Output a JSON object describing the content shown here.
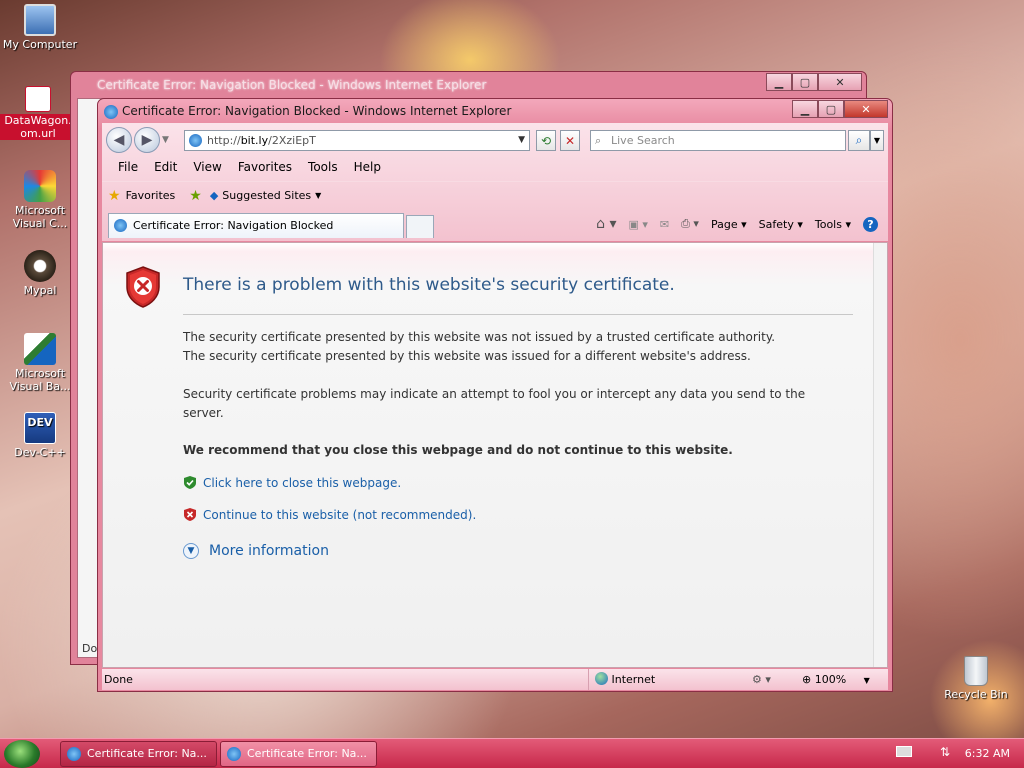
{
  "desktop": {
    "icons": [
      {
        "label": "My Computer"
      },
      {
        "label": "DataWagon.\nom.url"
      },
      {
        "label": "Microsoft\nVisual C..."
      },
      {
        "label": "Mypal"
      },
      {
        "label": "Microsoft\nVisual Ba..."
      },
      {
        "label": "Dev-C++"
      },
      {
        "label": "Recycle Bin"
      }
    ]
  },
  "back_window": {
    "title": "Certificate Error: Navigation Blocked - Windows Internet Explorer",
    "status": "Don"
  },
  "window": {
    "title": "Certificate Error: Navigation Blocked - Windows Internet Explorer",
    "address": {
      "scheme": "http://",
      "host": "bit.ly",
      "path": "/2XziEpT"
    },
    "search_placeholder": "Live Search",
    "menu": [
      "File",
      "Edit",
      "View",
      "Favorites",
      "Tools",
      "Help"
    ],
    "favorites_label": "Favorites",
    "suggested_sites": "Suggested Sites",
    "tab_title": "Certificate Error: Navigation Blocked",
    "commands": {
      "page": "Page",
      "safety": "Safety",
      "tools": "Tools"
    },
    "content": {
      "heading": "There is a problem with this website's security certificate.",
      "line1": "The security certificate presented by this website was not issued by a trusted certificate authority.",
      "line2": "The security certificate presented by this website was issued for a different website's address.",
      "para2": "Security certificate problems may indicate an attempt to fool you or intercept any data you send to the server.",
      "recommend": "We recommend that you close this webpage and do not continue to this website.",
      "close_link": "Click here to close this webpage.",
      "continue_link": "Continue to this website (not recommended).",
      "more_info": "More information"
    },
    "status": {
      "left": "Done",
      "zone": "Internet",
      "zoom": "100%"
    }
  },
  "taskbar": {
    "items": [
      "Certificate Error: Na...",
      "Certificate Error: Na..."
    ],
    "clock": "6:32 AM"
  },
  "colors": {
    "accent": "#e7889f",
    "link": "#1a5fa8",
    "heading": "#2e5a8a",
    "taskbar": "#c7284a"
  }
}
